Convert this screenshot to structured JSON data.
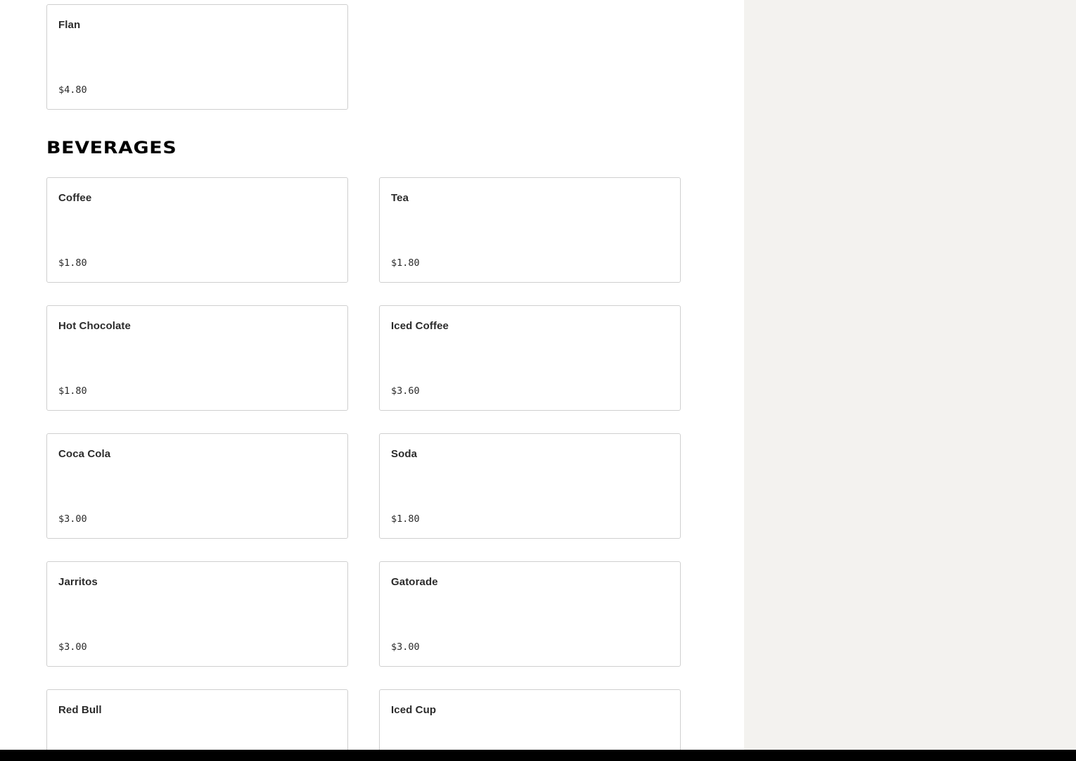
{
  "sections": [
    {
      "items": [
        {
          "name": "Flan",
          "price": "$4.80"
        }
      ]
    },
    {
      "title": "BEVERAGES",
      "items": [
        {
          "name": "Coffee",
          "price": "$1.80"
        },
        {
          "name": "Tea",
          "price": "$1.80"
        },
        {
          "name": "Hot Chocolate",
          "price": "$1.80"
        },
        {
          "name": "Iced Coffee",
          "price": "$3.60"
        },
        {
          "name": "Coca Cola",
          "price": "$3.00"
        },
        {
          "name": "Soda",
          "price": "$1.80"
        },
        {
          "name": "Jarritos",
          "price": "$3.00"
        },
        {
          "name": "Gatorade",
          "price": "$3.00"
        },
        {
          "name": "Red Bull",
          "price": ""
        },
        {
          "name": "Iced Cup",
          "price": ""
        }
      ]
    }
  ]
}
